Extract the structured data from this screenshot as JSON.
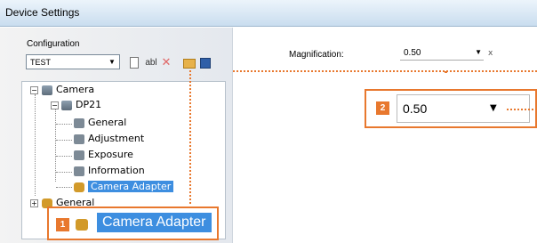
{
  "window": {
    "title": "Device Settings"
  },
  "configuration": {
    "label": "Configuration",
    "selected": "TEST",
    "toolbar": {
      "rename_text": "abl"
    }
  },
  "tree": {
    "camera": "Camera",
    "dp21": "DP21",
    "children": [
      "General",
      "Adjustment",
      "Exposure",
      "Information",
      "Camera Adapter"
    ],
    "general": "General"
  },
  "settings": {
    "magnification_label": "Magnification:",
    "magnification_value": "0.50",
    "unit": "x"
  },
  "callouts": {
    "one": {
      "number": "1",
      "label": "Camera Adapter"
    },
    "two": {
      "number": "2",
      "value": "0.50"
    }
  },
  "colors": {
    "accent": "#e8782e",
    "selection": "#3d8ee0"
  }
}
